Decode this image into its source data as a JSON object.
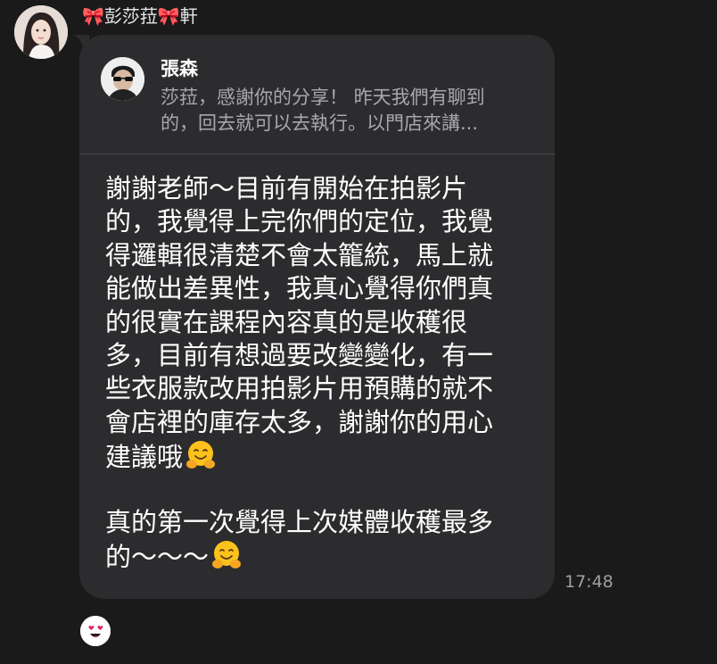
{
  "chat": {
    "sender_name": "🎀彭莎菈🎀軒",
    "sender_avatar_icon": "profile-photo-woman",
    "reply": {
      "author": "張森",
      "author_avatar_icon": "profile-photo-man-sunglasses",
      "preview_lines": [
        "莎菈，感謝你的分享！ 昨天我們有聊到",
        "的，回去就可以去執行。以門店來講..."
      ]
    },
    "message_lines": [
      "謝謝老師～目前有開始在拍影片",
      "的，我覺得上完你們的定位，我覺",
      "得邏輯很清楚不會太籠統，馬上就",
      "能做出差異性，我真心覺得你們真",
      "的很實在課程內容真的是收穫很",
      "多，目前有想過要改變變化，有一",
      "些衣服款改用拍影片用預購的就不",
      "會店裡的庫存太多，謝謝你的用心",
      "建議哦",
      "",
      "真的第一次覺得上次媒體收穫最多",
      "的～～～"
    ],
    "emoji": "hugging-face-emoji",
    "timestamp": "17:48",
    "reaction": "heart-eyes-emoji"
  },
  "colors": {
    "background": "#1a1a1b",
    "bubble": "#2c2c2e",
    "text": "#ffffff",
    "muted": "#a8a8ab"
  }
}
